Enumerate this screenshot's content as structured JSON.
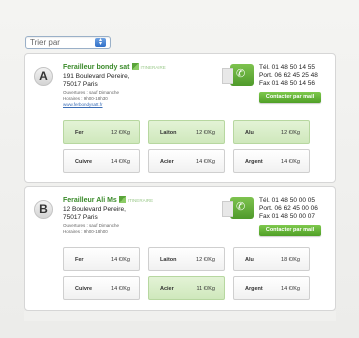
{
  "sort": {
    "label": "Trier par"
  },
  "cards": [
    {
      "letter": "A",
      "name": "Ferailleur bondy sat",
      "itinerary": "ITINERAIRE",
      "address1": "191 Boulevard Pereire,",
      "address2": "75017 Paris",
      "hours_open": "Ouvertures : sauf Dimanche",
      "hours": "Horaires : 9h00-18h30",
      "website": "www.ferbondysatt.fr",
      "tel": "Tél. 01 48 50 14 55",
      "port": "Port. 06 62 45 25 48",
      "fax": "Fax 01 48 50 14 56",
      "contact_button": "Contacter par mail",
      "prices": [
        {
          "metal": "Fer",
          "price": "12 €/Kg",
          "highlight": true
        },
        {
          "metal": "Laiton",
          "price": "12 €/Kg",
          "highlight": true
        },
        {
          "metal": "Alu",
          "price": "12 €/Kg",
          "highlight": true
        },
        {
          "metal": "Cuivre",
          "price": "14 €/Kg",
          "highlight": false
        },
        {
          "metal": "Acier",
          "price": "14 €/Kg",
          "highlight": false
        },
        {
          "metal": "Argent",
          "price": "14 €/Kg",
          "highlight": false
        }
      ]
    },
    {
      "letter": "B",
      "name": "Ferailleur Ali Ms",
      "itinerary": "ITINERAIRE",
      "address1": "12 Boulevard Pereire,",
      "address2": "75017 Paris",
      "hours_open": "Ouvertures : sauf Dimanche",
      "hours": "Horaires : 9h00-18h00",
      "website": "",
      "tel": "Tél. 01 48 50 00 05",
      "port": "Port. 06 62 45 00 06",
      "fax": "Fax 01 48 50 00 07",
      "contact_button": "Contacter par mail",
      "prices": [
        {
          "metal": "Fer",
          "price": "14 €/Kg",
          "highlight": false
        },
        {
          "metal": "Laiton",
          "price": "12 €/Kg",
          "highlight": false
        },
        {
          "metal": "Alu",
          "price": "18 €/Kg",
          "highlight": false
        },
        {
          "metal": "Cuivre",
          "price": "14 €/Kg",
          "highlight": false
        },
        {
          "metal": "Acier",
          "price": "11 €/Kg",
          "highlight": true
        },
        {
          "metal": "Argent",
          "price": "14 €/Kg",
          "highlight": false
        }
      ]
    }
  ]
}
